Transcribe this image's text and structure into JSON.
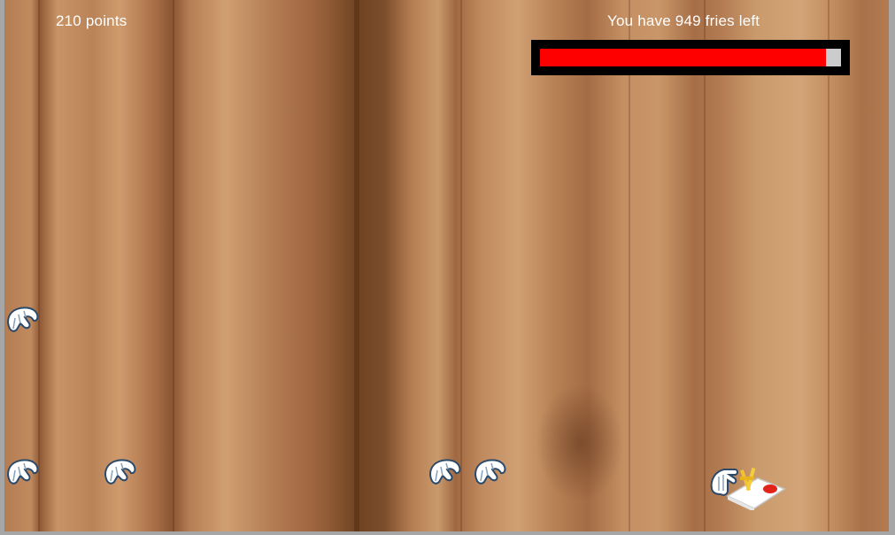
{
  "hud": {
    "score_text": "210 points",
    "fries_text": "You have 949 fries left",
    "fries_fraction": 0.949
  },
  "colors": {
    "bar_fill": "#ff0000",
    "bar_track": "#cccccc",
    "bar_border": "#000000",
    "text": "#ffffff"
  },
  "sprites": {
    "enemy_icon": "grabbing-glove-hand-icon",
    "player_icon": "fries-tray-with-glove-icon"
  }
}
